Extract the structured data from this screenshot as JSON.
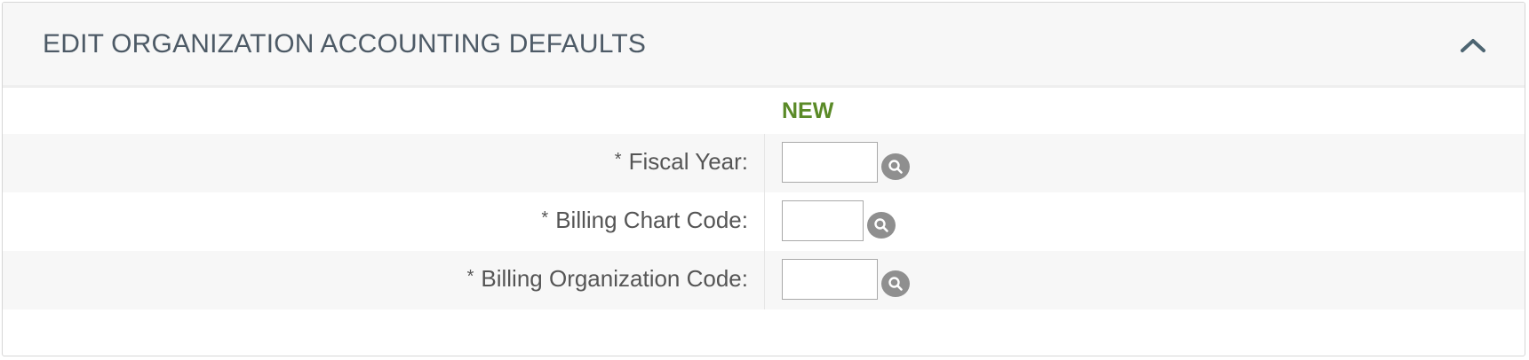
{
  "panel": {
    "title": "EDIT ORGANIZATION ACCOUNTING DEFAULTS",
    "collapse_icon": "chevron-up-icon"
  },
  "table": {
    "column_header": "NEW",
    "rows": [
      {
        "required_marker": "*",
        "label": "Fiscal Year:",
        "value": "",
        "lookup_icon": "search-icon"
      },
      {
        "required_marker": "*",
        "label": "Billing Chart Code:",
        "value": "",
        "lookup_icon": "search-icon"
      },
      {
        "required_marker": "*",
        "label": "Billing Organization Code:",
        "value": "",
        "lookup_icon": "search-icon"
      }
    ]
  },
  "colors": {
    "title": "#4d5a66",
    "new_header": "#5a8a27",
    "label": "#555555",
    "row_shade": "#f7f7f7",
    "lookup_button": "#8f8f8f"
  }
}
